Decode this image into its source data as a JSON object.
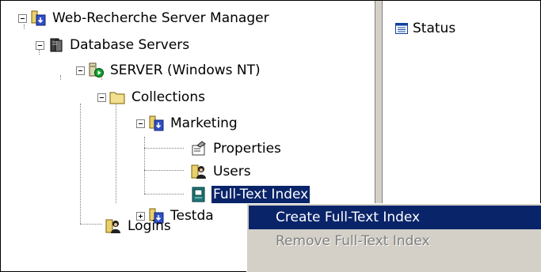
{
  "tree": {
    "root": {
      "label": "Web-Recherche Server Manager",
      "icon": "server-manager-icon"
    },
    "database_servers": {
      "label": "Database Servers",
      "icon": "database-servers-icon"
    },
    "server": {
      "label": "SERVER (Windows NT)",
      "icon": "server-running-icon"
    },
    "collections": {
      "label": "Collections",
      "icon": "folder-icon"
    },
    "marketing": {
      "label": "Marketing",
      "icon": "collection-icon"
    },
    "properties": {
      "label": "Properties",
      "icon": "properties-icon"
    },
    "users": {
      "label": "Users",
      "icon": "users-icon"
    },
    "full_text_index": {
      "label": "Full-Text Index",
      "icon": "full-text-index-icon"
    },
    "testdata": {
      "label": "Testda",
      "icon": "collection-icon"
    },
    "logins": {
      "label": "Logins",
      "icon": "logins-icon"
    }
  },
  "right_pane": {
    "status": {
      "label": "Status",
      "icon": "list-icon"
    }
  },
  "context_menu": {
    "items": [
      {
        "label": "Create Full-Text Index",
        "state": "highlighted"
      },
      {
        "label": "Remove Full-Text Index",
        "state": "disabled"
      }
    ]
  },
  "colors": {
    "selection": "#0a246a",
    "menu_background": "#d4d0c8",
    "disabled_text": "#808080"
  }
}
